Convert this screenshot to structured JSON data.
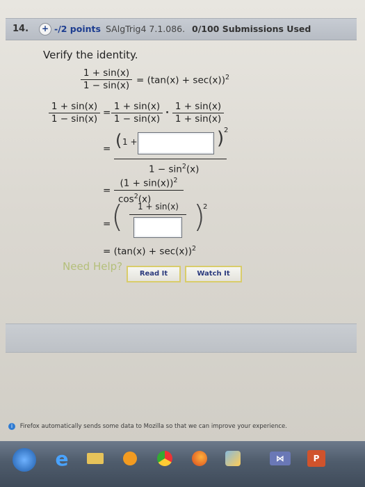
{
  "question": {
    "number": "14.",
    "plus": "+",
    "points": "-/2 points",
    "code": "SAlgTrig4 7.1.086.",
    "submissions": "0/100 Submissions Used"
  },
  "prompt": "Verify the identity.",
  "math": {
    "eq1_num": "1 + sin(x)",
    "eq1_den": "1 − sin(x)",
    "eq1_rhs": "= (tan(x) + sec(x))",
    "eq1_exp": "2",
    "row1_lhs_num": "1 + sin(x)",
    "row1_lhs_den": "1 − sin(x)",
    "eq_sign": "=",
    "row1_a_num": "1 + sin(x)",
    "row1_a_den": "1 − sin(x)",
    "dot": "·",
    "row1_b_num": "1 + sin(x)",
    "row1_b_den": "1 + sin(x)",
    "row2_open": "(1 +",
    "row2_close": ")",
    "row2_exp": "2",
    "row2_den": "1 − sin",
    "row2_den_exp": "2",
    "row2_den_tail": "(x)",
    "row3_num": "(1 + sin(x))",
    "row3_num_exp": "2",
    "row3_den": "cos",
    "row3_den_exp": "2",
    "row3_den_tail": "(x)",
    "row4_num": "1 + sin(x)",
    "row4_exp": "2",
    "row4_open": "(",
    "row4_close": ")",
    "final": "= (tan(x) + sec(x))",
    "final_exp": "2"
  },
  "help": {
    "label": "Need Help?",
    "read": "Read It",
    "watch": "Watch It"
  },
  "notice": "Firefox automatically sends some data to Mozilla so that we can improve your experience.",
  "taskbar": {
    "icons": [
      "windows-start",
      "internet-explorer",
      "file-explorer",
      "windows-media",
      "chrome",
      "firefox",
      "paint",
      "messenger",
      "powerpoint"
    ]
  }
}
